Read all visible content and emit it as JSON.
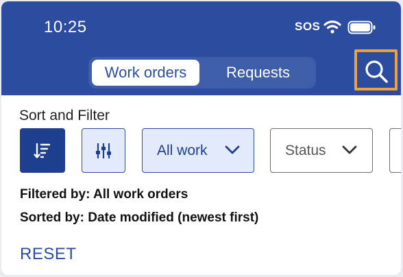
{
  "status_bar": {
    "time": "10:25",
    "sos": "SOS",
    "wifi_icon": "wifi-icon",
    "battery_icon": "battery-icon"
  },
  "tabs": [
    {
      "label": "Work orders",
      "active": true
    },
    {
      "label": "Requests",
      "active": false
    }
  ],
  "search": {
    "icon": "search-icon"
  },
  "sort_filter": {
    "title": "Sort and Filter",
    "sort_icon": "sort-descending-icon",
    "filter_icon": "sliders-icon",
    "all_work_label": "All work",
    "status_label": "Status"
  },
  "summary": {
    "filtered_by": "Filtered by: All work orders",
    "sorted_by": "Sorted by: Date modified (newest first)"
  },
  "reset_label": "RESET",
  "colors": {
    "header": "#2b4c9f",
    "accent_dark": "#1d3f8f",
    "chip_selected_bg": "#e3ebfb",
    "focus_outline": "#f0a23a"
  }
}
